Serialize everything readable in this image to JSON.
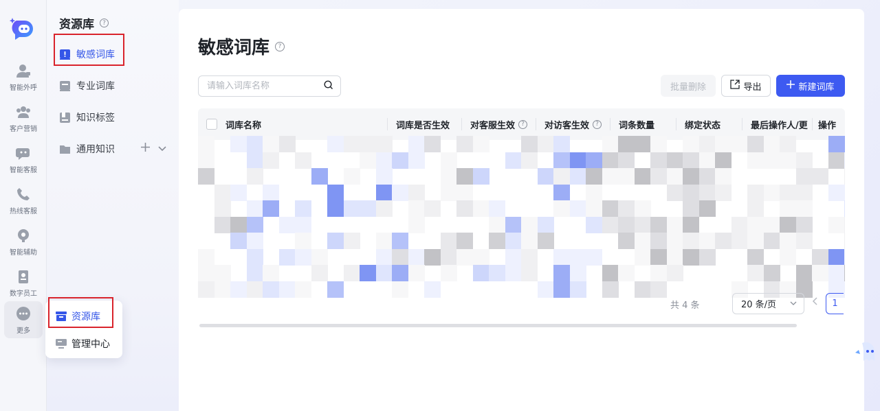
{
  "rail": {
    "items": [
      {
        "label": "智能外呼",
        "icon": "headset-user-icon"
      },
      {
        "label": "客户营销",
        "icon": "users-icon"
      },
      {
        "label": "智能客服",
        "icon": "chat-bot-icon"
      },
      {
        "label": "热线客服",
        "icon": "phone-icon"
      },
      {
        "label": "智能辅助",
        "icon": "assist-icon"
      },
      {
        "label": "数字员工",
        "icon": "badge-icon"
      },
      {
        "label": "更多",
        "icon": "more-icon"
      }
    ]
  },
  "sidebar": {
    "title": "资源库",
    "items": [
      {
        "label": "敏感词库",
        "icon": "alert-book-icon"
      },
      {
        "label": "专业词库",
        "icon": "book-icon"
      },
      {
        "label": "知识标签",
        "icon": "tag-icon"
      },
      {
        "label": "通用知识",
        "icon": "folder-icon"
      }
    ]
  },
  "popover": {
    "items": [
      {
        "label": "资源库",
        "icon": "archive-icon"
      },
      {
        "label": "管理中心",
        "icon": "monitor-icon"
      }
    ]
  },
  "main": {
    "title": "敏感词库",
    "search_placeholder": "请输入词库名称",
    "btn_batch_delete": "批量删除",
    "btn_export": "导出",
    "btn_new": "新建词库",
    "columns": [
      "词库名称",
      "词库是否生效",
      "对客服生效",
      "对访客生效",
      "词条数量",
      "绑定状态",
      "最后操作人/更",
      "操作"
    ],
    "total": "共 4 条",
    "page_size": "20 条/页",
    "current_page": "1"
  },
  "colors": {
    "accent": "#3d5af1",
    "highlight_box": "#d9232b"
  }
}
